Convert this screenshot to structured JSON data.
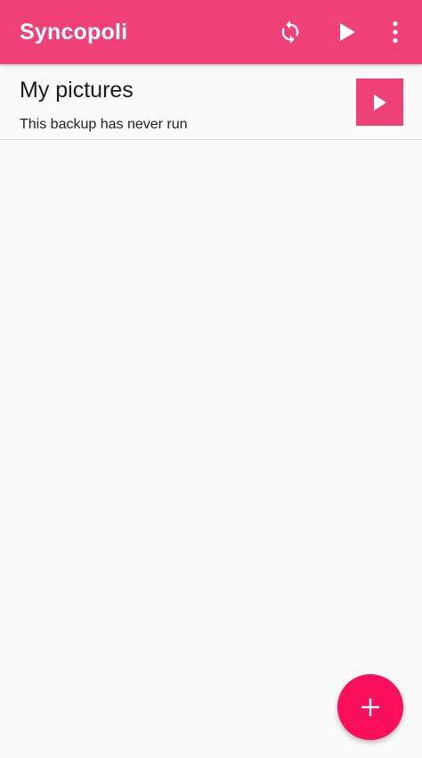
{
  "app": {
    "title": "Syncopoli"
  },
  "colors": {
    "appbar": "#ef4078",
    "accent": "#ef4078",
    "fab": "#fb0e5c",
    "icon": "#ffffff",
    "background": "#fafafa"
  },
  "toolbar": {
    "actions": [
      {
        "icon": "sync-icon"
      },
      {
        "icon": "play-icon"
      },
      {
        "icon": "more-vert-icon"
      }
    ]
  },
  "backups": [
    {
      "name": "My pictures",
      "status": "This backup has never run",
      "run_icon": "play-icon"
    }
  ],
  "fab": {
    "icon": "plus-icon"
  }
}
